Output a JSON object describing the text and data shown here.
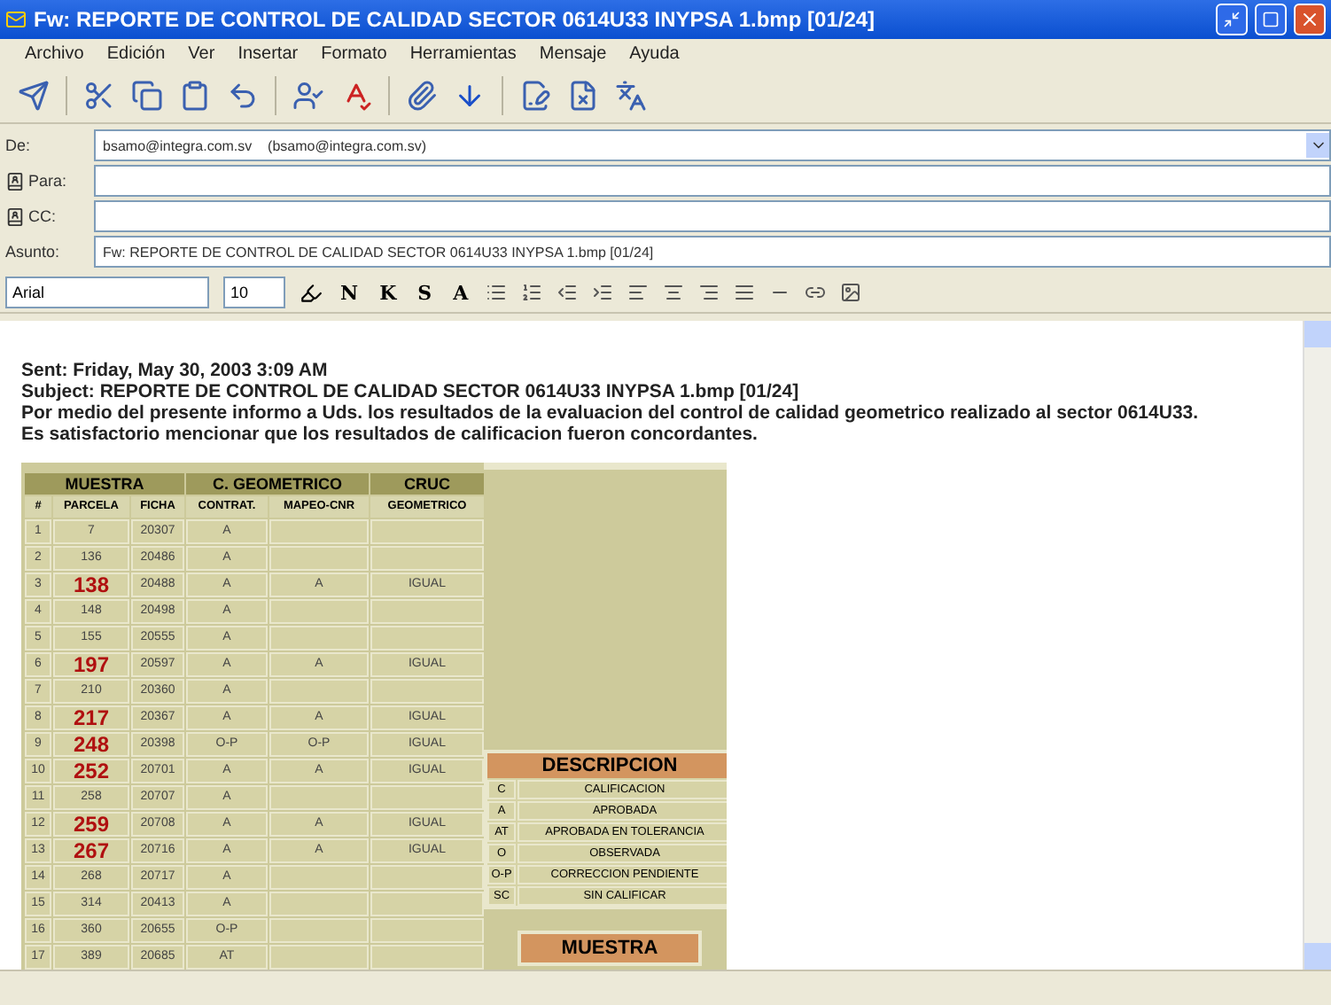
{
  "window": {
    "title": "Fw: REPORTE DE CONTROL DE CALIDAD SECTOR 0614U33 INYPSA 1.bmp [01/24]"
  },
  "menu": [
    "Archivo",
    "Edición",
    "Ver",
    "Insertar",
    "Formato",
    "Herramientas",
    "Mensaje",
    "Ayuda"
  ],
  "fields": [
    {
      "label": "De:",
      "value": "bsamo@integra.com.sv    (bsamo@integra.com.sv)",
      "kind": "dropdown"
    },
    {
      "label": "Para:",
      "kind": "address"
    },
    {
      "label": "CC:",
      "kind": "address"
    },
    {
      "label": "Asunto:",
      "value": "Fw: REPORTE DE CONTROL DE CALIDAD SECTOR 0614U33 INYPSA 1.bmp [01/24]",
      "kind": "text"
    }
  ],
  "format_bar": {
    "font": "Arial",
    "size": "10",
    "buttons": [
      "N",
      "K",
      "S",
      "A"
    ]
  },
  "message": {
    "lines": [
      "Sent: Friday, May 30, 2003 3:09 AM",
      "Subject: REPORTE DE CONTROL DE CALIDAD SECTOR 0614U33 INYPSA 1.bmp [01/24]",
      "Por medio del presente informo a Uds. los resultados de la evaluacion del control de calidad geometrico realizado al sector 0614U33.",
      "Es satisfactorio mencionar que los resultados de calificacion fueron concordantes."
    ]
  },
  "report": {
    "groups": [
      "MUESTRA",
      "C. GEOMETRICO",
      "CRUC"
    ],
    "columns": [
      "#",
      "PARCELA",
      "FICHA",
      "CONTRAT.",
      "MAPEO-CNR",
      "GEOMETRICO"
    ],
    "rows": [
      {
        "n": "1",
        "parcela": "7",
        "ficha": "20307",
        "contrat": "A",
        "highlight": false
      },
      {
        "n": "2",
        "parcela": "136",
        "ficha": "20486",
        "contrat": "A",
        "highlight": false
      },
      {
        "n": "3",
        "parcela": "138",
        "ficha": "20488",
        "contrat": "A",
        "mapeo": "A",
        "geometrico": "IGUAL",
        "highlight": true
      },
      {
        "n": "4",
        "parcela": "148",
        "ficha": "20498",
        "contrat": "A",
        "highlight": false
      },
      {
        "n": "5",
        "parcela": "155",
        "ficha": "20555",
        "contrat": "A",
        "highlight": false
      },
      {
        "n": "6",
        "parcela": "197",
        "ficha": "20597",
        "contrat": "A",
        "mapeo": "A",
        "geometrico": "IGUAL",
        "highlight": true
      },
      {
        "n": "7",
        "parcela": "210",
        "ficha": "20360",
        "contrat": "A",
        "highlight": false
      },
      {
        "n": "8",
        "parcela": "217",
        "ficha": "20367",
        "contrat": "A",
        "mapeo": "A",
        "geometrico": "IGUAL",
        "highlight": true
      },
      {
        "n": "9",
        "parcela": "248",
        "ficha": "20398",
        "contrat": "O-P",
        "mapeo": "O-P",
        "geometrico": "IGUAL",
        "highlight": true
      },
      {
        "n": "10",
        "parcela": "252",
        "ficha": "20701",
        "contrat": "A",
        "mapeo": "A",
        "geometrico": "IGUAL",
        "highlight": true
      },
      {
        "n": "11",
        "parcela": "258",
        "ficha": "20707",
        "contrat": "A",
        "highlight": false
      },
      {
        "n": "12",
        "parcela": "259",
        "ficha": "20708",
        "contrat": "A",
        "mapeo": "A",
        "geometrico": "IGUAL",
        "highlight": true
      },
      {
        "n": "13",
        "parcela": "267",
        "ficha": "20716",
        "contrat": "A",
        "mapeo": "A",
        "geometrico": "IGUAL",
        "highlight": true
      },
      {
        "n": "14",
        "parcela": "268",
        "ficha": "20717",
        "contrat": "A",
        "highlight": false
      },
      {
        "n": "15",
        "parcela": "314",
        "ficha": "20413",
        "contrat": "A",
        "highlight": false
      },
      {
        "n": "16",
        "parcela": "360",
        "ficha": "20655",
        "contrat": "O-P",
        "highlight": false
      },
      {
        "n": "17",
        "parcela": "389",
        "ficha": "20685",
        "contrat": "AT",
        "highlight": false
      }
    ],
    "legend": {
      "title": "DESCRIPCION",
      "items": [
        {
          "code": "C",
          "text": "CALIFICACION"
        },
        {
          "code": "A",
          "text": "APROBADA"
        },
        {
          "code": "AT",
          "text": "APROBADA EN TOLERANCIA"
        },
        {
          "code": "O",
          "text": "OBSERVADA"
        },
        {
          "code": "O-P",
          "text": "CORRECCION PENDIENTE"
        },
        {
          "code": "SC",
          "text": "SIN CALIFICAR"
        }
      ]
    },
    "sample_title": "MUESTRA"
  }
}
